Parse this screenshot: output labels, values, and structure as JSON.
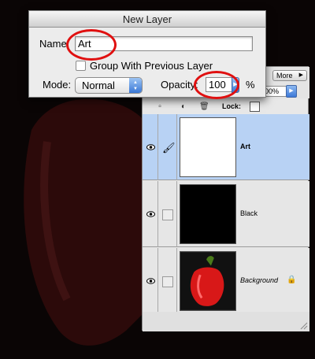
{
  "dialog": {
    "title": "New Layer",
    "name_label": "Name:",
    "name_value": "Art",
    "group_label": "Group With Previous Layer",
    "group_checked": false,
    "mode_label": "Mode:",
    "mode_value": "Normal",
    "opacity_label": "Opacity:",
    "opacity_value": "100",
    "opacity_unit": "%"
  },
  "palette": {
    "more_label": "More",
    "fill_value": "100%",
    "lock_label": "Lock:",
    "layers": [
      {
        "name": "Art",
        "selected": true,
        "thumbnail": "white"
      },
      {
        "name": "Black",
        "selected": false,
        "thumbnail": "black"
      },
      {
        "name": "Background",
        "selected": false,
        "thumbnail": "red-pepper",
        "locked": true
      }
    ]
  },
  "colors": {
    "highlight_circle": "#e01010",
    "selected_layer": "#b8d2f4",
    "accent": "#3a78d6"
  }
}
